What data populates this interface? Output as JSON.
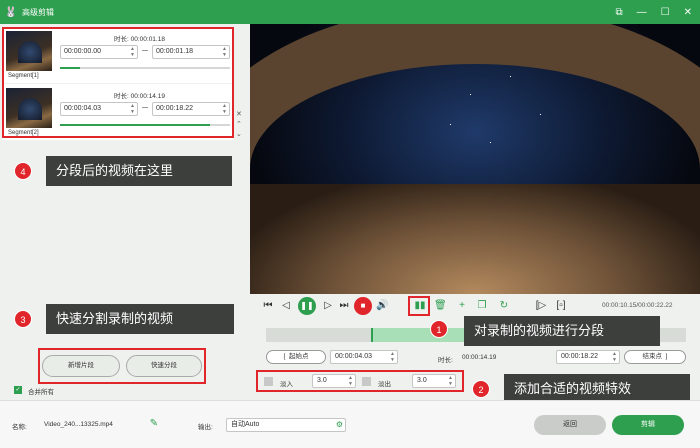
{
  "app": {
    "title": "高级剪辑"
  },
  "colors": {
    "accent": "#2e9e4f",
    "highlight": "#e0262b",
    "callout_bg": "#3d3f3d"
  },
  "icons": [
    "app-logo-icon",
    "window-restore-icon",
    "window-minimize-icon",
    "window-maximize-icon",
    "window-close-icon"
  ],
  "segments": [
    {
      "label": "Segment[1]",
      "duration_label": "时长:",
      "duration": "00:00:01.18",
      "start": "00:00:00.00",
      "end": "00:00:01.18",
      "progress": 0.12
    },
    {
      "label": "Segment[2]",
      "duration_label": "时长:",
      "duration": "00:00:14.19",
      "start": "00:00:04.03",
      "end": "00:00:18.22",
      "progress": 0.88
    }
  ],
  "callouts": [
    {
      "num": "1",
      "text": "对录制的视频进行分段"
    },
    {
      "num": "2",
      "text": "添加合适的视频特效"
    },
    {
      "num": "3",
      "text": "快速分割录制的视频"
    },
    {
      "num": "4",
      "text": "分段后的视频在这里"
    }
  ],
  "left_panel": {
    "new_segment": "新增片段",
    "quick_split": "快速分段",
    "merge_all": "合并所有"
  },
  "player": {
    "time": "00:00:10.15/00:00:22.22",
    "timeline_start": 0.25,
    "timeline_end": 0.76
  },
  "trim": {
    "start_label": "起始点",
    "start_value": "00:00:04.03",
    "duration_label": "时长:",
    "duration_value": "00:00:14.19",
    "end_value": "00:00:18.22",
    "end_label": "结束点"
  },
  "effects": {
    "fade_in_label": "淡入",
    "fade_in_value": "3.0",
    "fade_out_label": "淡出",
    "fade_out_value": "3.0"
  },
  "bottom": {
    "name_label": "名称:",
    "name_value": "Video_240...13325.mp4",
    "output_label": "输出:",
    "output_value": "自动Auto",
    "back": "返回",
    "edit": "剪辑"
  }
}
